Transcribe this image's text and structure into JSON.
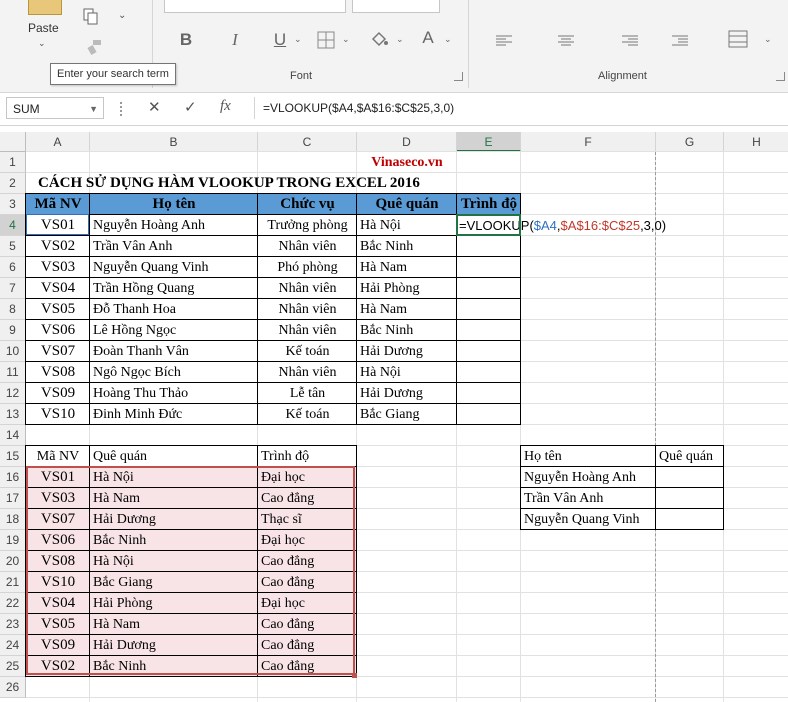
{
  "ribbon": {
    "clipboard_label": "Paste",
    "font_group_label": "Font",
    "alignment_group_label": "Alignment",
    "tooltip": "Enter your search term",
    "bold": "B",
    "italic": "I",
    "underline": "U",
    "font_color": "A"
  },
  "formula_bar": {
    "name_box": "SUM",
    "formula": "=VLOOKUP($A4,$A$16:$C$25,3,0)"
  },
  "columns": [
    "A",
    "B",
    "C",
    "D",
    "E",
    "F",
    "G",
    "H"
  ],
  "rows": [
    "1",
    "2",
    "3",
    "4",
    "5",
    "6",
    "7",
    "8",
    "9",
    "10",
    "11",
    "12",
    "13",
    "14",
    "15",
    "16",
    "17",
    "18",
    "19",
    "20",
    "21",
    "22",
    "23",
    "24",
    "25",
    "26"
  ],
  "sheet": {
    "brand": "Vinaseco.vn",
    "title": "CÁCH SỬ DỤNG HÀM VLOOKUP TRONG EXCEL 2016",
    "table1_headers": [
      "Mã NV",
      "Họ tên",
      "Chức vụ",
      "Quê quán",
      "Trình độ"
    ],
    "table1_rows": [
      [
        "VS01",
        "Nguyễn Hoàng Anh",
        "Trưởng phòng",
        "Hà Nội"
      ],
      [
        "VS02",
        "Trần Vân Anh",
        "Nhân viên",
        "Bắc Ninh"
      ],
      [
        "VS03",
        "Nguyễn Quang Vinh",
        "Phó phòng",
        "Hà Nam"
      ],
      [
        "VS04",
        "Trần Hồng Quang",
        "Nhân viên",
        "Hải Phòng"
      ],
      [
        "VS05",
        "Đỗ Thanh Hoa",
        "Nhân viên",
        "Hà Nam"
      ],
      [
        "VS06",
        "Lê Hồng Ngọc",
        "Nhân viên",
        "Bắc Ninh"
      ],
      [
        "VS07",
        "Đoàn Thanh Vân",
        "Kế toán",
        "Hải Dương"
      ],
      [
        "VS08",
        "Ngô Ngọc Bích",
        "Nhân viên",
        "Hà Nội"
      ],
      [
        "VS09",
        "Hoàng Thu Thảo",
        "Lễ tân",
        "Hải Dương"
      ],
      [
        "VS10",
        "Đinh Minh Đức",
        "Kế toán",
        "Bắc Giang"
      ]
    ],
    "editing_formula": {
      "prefix": "=VLOOKUP(",
      "ref1": "$A4",
      "comma1": ",",
      "ref2": "$A$16:$C$25",
      "suffix": ",3,0)"
    },
    "table2_headers": [
      "Mã NV",
      "Quê quán",
      "Trình độ"
    ],
    "table2_rows": [
      [
        "VS01",
        "Hà Nội",
        "Đại học"
      ],
      [
        "VS03",
        "Hà Nam",
        "Cao đẳng"
      ],
      [
        "VS07",
        "Hải Dương",
        "Thạc sĩ"
      ],
      [
        "VS06",
        "Bắc Ninh",
        "Đại học"
      ],
      [
        "VS08",
        "Hà Nội",
        "Cao đẳng"
      ],
      [
        "VS10",
        "Bắc Giang",
        "Cao đẳng"
      ],
      [
        "VS04",
        "Hải Phòng",
        "Đại học"
      ],
      [
        "VS05",
        "Hà Nam",
        "Cao đẳng"
      ],
      [
        "VS09",
        "Hải Dương",
        "Cao đẳng"
      ],
      [
        "VS02",
        "Bắc Ninh",
        "Cao đẳng"
      ]
    ],
    "table3_headers": [
      "Họ tên",
      "Quê quán"
    ],
    "table3_rows": [
      "Nguyễn Hoàng Anh",
      "Trần Vân Anh",
      "Nguyễn Quang Vinh"
    ]
  },
  "colors": {
    "header_fill": "#5b9bd5",
    "brand_red": "#c00000",
    "ref_blue": "#2f6fc0",
    "ref_red": "#c0392b",
    "range_fill": "#f8e4e6",
    "range_border": "#c0504d",
    "excel_green": "#217346"
  }
}
